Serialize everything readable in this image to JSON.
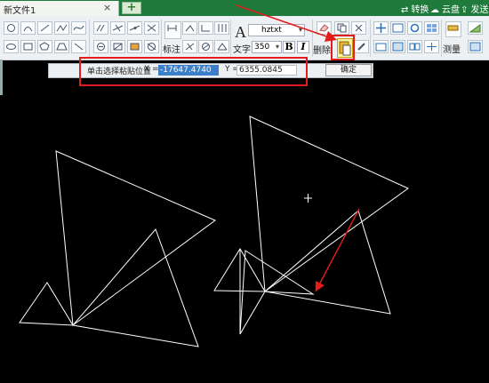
{
  "tabs": {
    "document_title": "新文件1",
    "close_symbol": "×",
    "new_tab_symbol": "+"
  },
  "top_actions": [
    {
      "icon": "switch-icon",
      "label": "转换"
    },
    {
      "icon": "cloud-icon",
      "label": "云盘"
    },
    {
      "icon": "send-icon",
      "label": "发送"
    }
  ],
  "ribbon": {
    "dimension_label": "标注",
    "text_big_glyph": "A",
    "text_label": "文字",
    "font_name": "hztxt",
    "font_size": "350",
    "bold": "B",
    "italic": "I",
    "delete_label": "删除",
    "measure_label": "测量",
    "dropdown_symbol": "▾"
  },
  "paste_bar": {
    "prompt": "单击选择粘贴位置",
    "x_label": "X =",
    "x_value": "-17647.4740",
    "y_label": "Y =",
    "y_value": "6355.0845",
    "confirm": "确定"
  },
  "colors": {
    "canvas_background": "#000000",
    "drawing_lines": "#ffffff",
    "annotation_red": "#e41b1b",
    "title_bar_green": "#1f7a3c",
    "selection_blue": "#3b7ec9"
  }
}
